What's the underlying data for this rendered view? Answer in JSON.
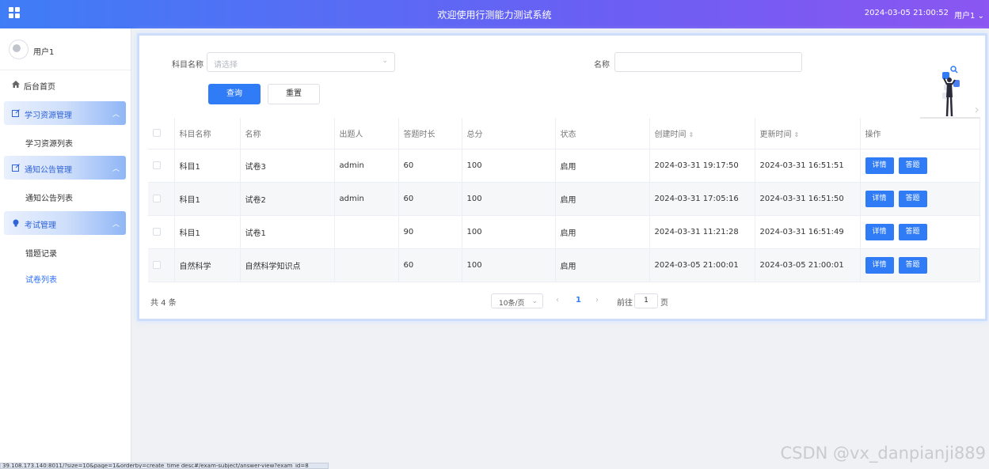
{
  "header": {
    "title": "欢迎使用行测能力测试系统",
    "datetime": "2024-03-05 21:00:52",
    "user": "用户1"
  },
  "sidebar": {
    "username": "用户1",
    "home": "后台首页",
    "groups": [
      {
        "label": "学习资源管理",
        "items": [
          "学习资源列表"
        ]
      },
      {
        "label": "通知公告管理",
        "items": [
          "通知公告列表"
        ]
      },
      {
        "label": "考试管理",
        "items": [
          "错题记录",
          "试卷列表"
        ]
      }
    ]
  },
  "filters": {
    "subject_label": "科目名称",
    "subject_placeholder": "请选择",
    "name_label": "名称",
    "name_value": "",
    "query_label": "查询",
    "reset_label": "重置"
  },
  "table": {
    "headers": [
      "科目名称",
      "名称",
      "出题人",
      "答题时长",
      "总分",
      "状态",
      "创建时间",
      "更新时间",
      "操作"
    ],
    "rows": [
      [
        "科目1",
        "试卷3",
        "admin",
        "60",
        "100",
        "启用",
        "2024-03-31 19:17:50",
        "2024-03-31 16:51:51"
      ],
      [
        "科目1",
        "试卷2",
        "admin",
        "60",
        "100",
        "启用",
        "2024-03-31 17:05:16",
        "2024-03-31 16:51:50"
      ],
      [
        "科目1",
        "试卷1",
        "",
        "90",
        "100",
        "启用",
        "2024-03-31 11:21:28",
        "2024-03-31 16:51:49"
      ],
      [
        "自然科学",
        "自然科学知识点",
        "",
        "60",
        "100",
        "启用",
        "2024-03-05 21:00:01",
        "2024-03-05 21:00:01"
      ]
    ],
    "actions": [
      "详情",
      "答题"
    ]
  },
  "pagination": {
    "total": "共 4 条",
    "page_size": "10条/页",
    "current": "1",
    "goto_prefix": "前往",
    "goto_value": "1",
    "goto_suffix": "页"
  },
  "statusbar": "39.108.173.140:8011/?size=10&page=1&orderby=create_time desc#/exam-subject/answer-view?exam_id=8",
  "watermark": "CSDN @vx_danpianji889",
  "colors": {
    "primary": "#2f7cf6",
    "header_start": "#3f7df6",
    "header_end": "#8b56f1"
  }
}
